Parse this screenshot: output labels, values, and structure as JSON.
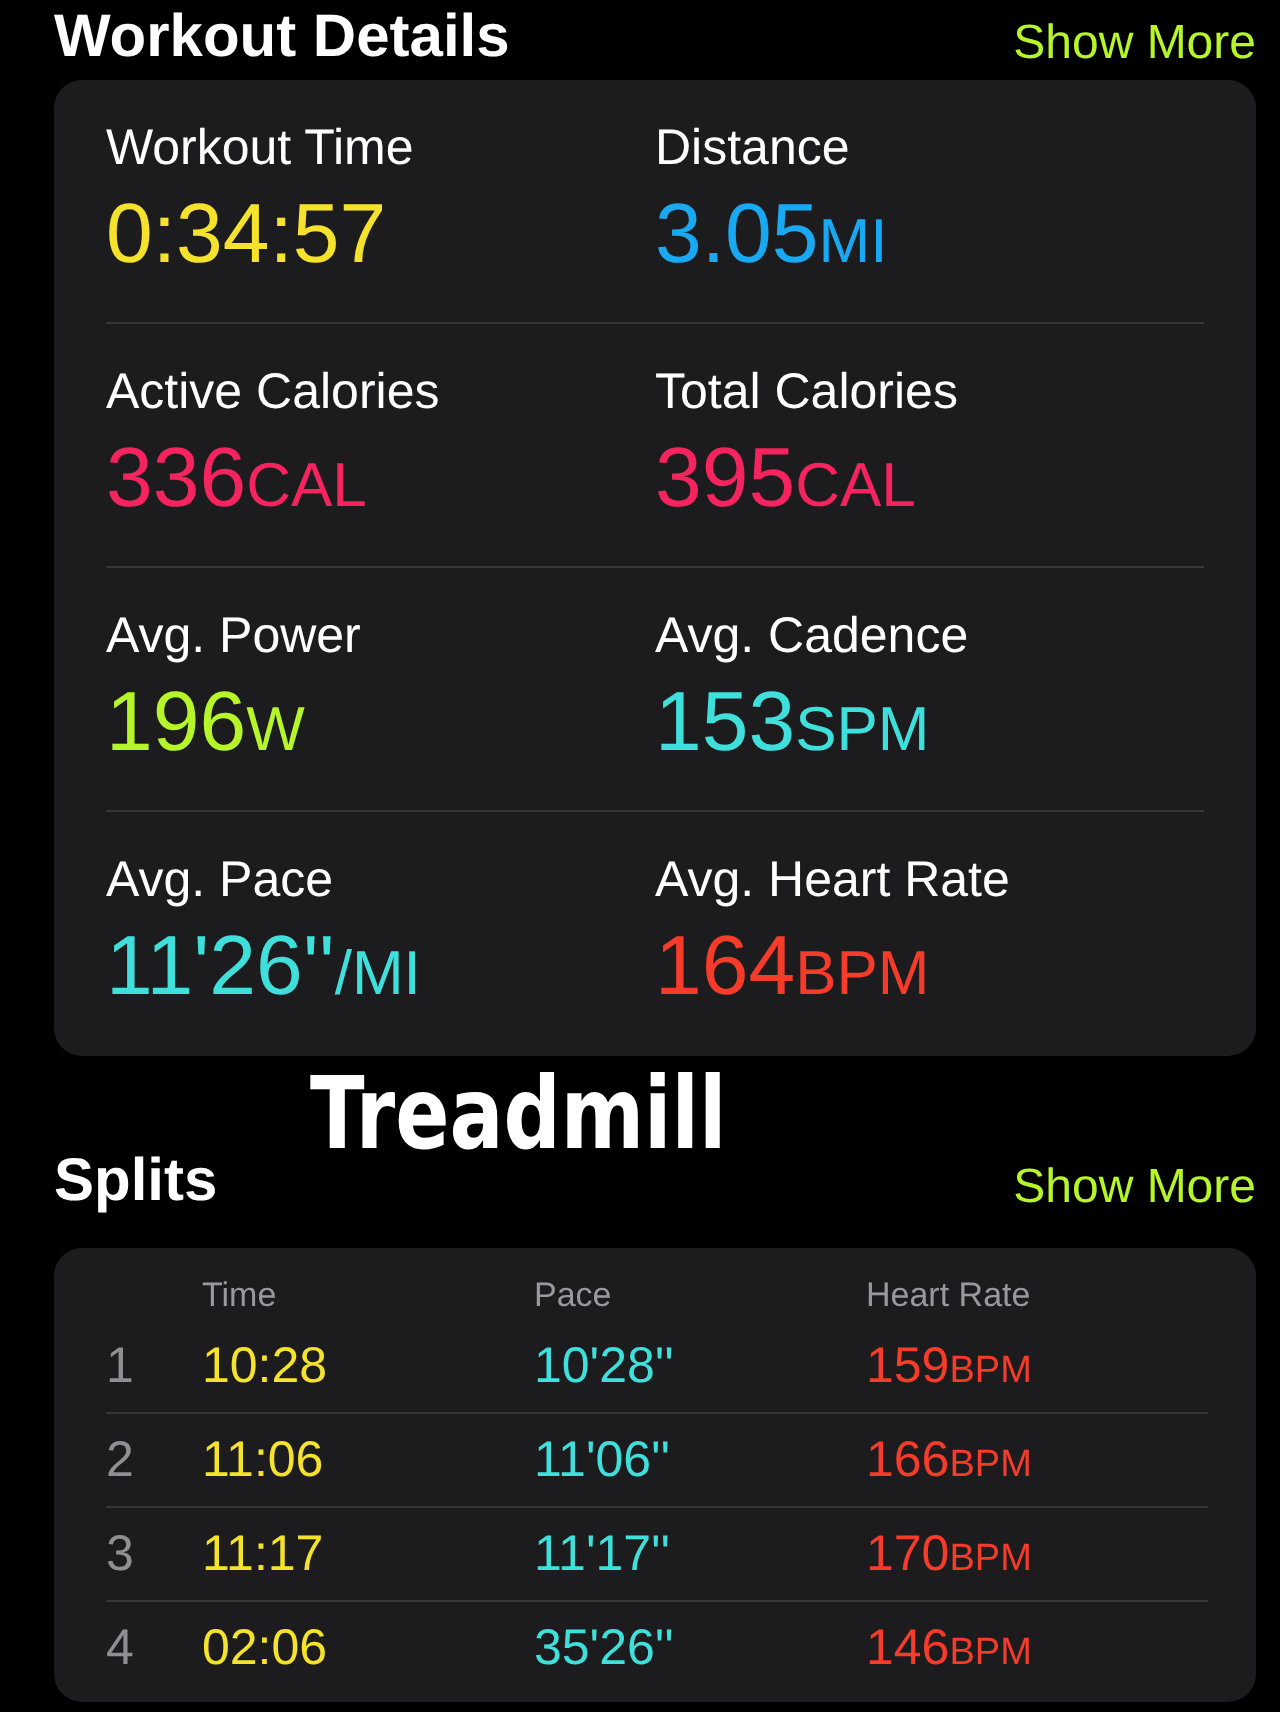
{
  "workout_details": {
    "title": "Workout Details",
    "action": "Show More",
    "metrics": [
      {
        "label": "Workout Time",
        "value": "0:34:57",
        "color": "#f5e22c"
      },
      {
        "label": "Distance",
        "value": "3.05",
        "unit": "MI",
        "color": "#19a9f2"
      },
      {
        "label": "Active Calories",
        "value": "336",
        "unit": "CAL",
        "color": "#f5245e"
      },
      {
        "label": "Total Calories",
        "value": "395",
        "unit": "CAL",
        "color": "#f5245e"
      },
      {
        "label": "Avg. Power",
        "value": "196",
        "unit": "W",
        "color": "#b5f52a"
      },
      {
        "label": "Avg. Cadence",
        "value": "153",
        "unit": "SPM",
        "color": "#3fe0dc"
      },
      {
        "label": "Avg. Pace",
        "value": "11'26''",
        "unit": "/MI",
        "color": "#3fe0dc"
      },
      {
        "label": "Avg. Heart Rate",
        "value": "164",
        "unit": "BPM",
        "color": "#f53b2a"
      }
    ]
  },
  "overlay_caption": "Treadmill",
  "splits": {
    "title": "Splits",
    "action": "Show More",
    "columns": [
      "Time",
      "Pace",
      "Heart Rate"
    ],
    "rows": [
      {
        "index": "1",
        "time": "10:28",
        "pace": "10'28''",
        "heart_rate": "159",
        "unit": "BPM"
      },
      {
        "index": "2",
        "time": "11:06",
        "pace": "11'06''",
        "heart_rate": "166",
        "unit": "BPM"
      },
      {
        "index": "3",
        "time": "11:17",
        "pace": "11'17''",
        "heart_rate": "170",
        "unit": "BPM"
      },
      {
        "index": "4",
        "time": "02:06",
        "pace": "35'26''",
        "heart_rate": "146",
        "unit": "BPM"
      }
    ]
  }
}
